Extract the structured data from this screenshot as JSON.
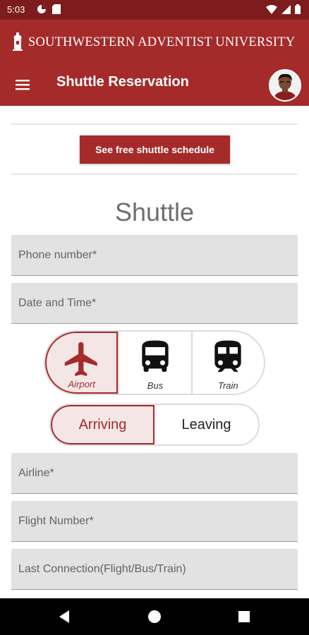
{
  "status_bar": {
    "time": "5:03"
  },
  "brand": {
    "name": "SOUTHWESTERN ADVENTIST UNIVERSITY"
  },
  "app_bar": {
    "title": "Shuttle Reservation"
  },
  "schedule_button": {
    "label": "See free shuttle schedule"
  },
  "section": {
    "title": "Shuttle"
  },
  "fields": {
    "phone": {
      "placeholder": "Phone number*",
      "value": ""
    },
    "date_time": {
      "placeholder": "Date and Time*",
      "value": ""
    },
    "airline": {
      "placeholder": "Airline*",
      "value": ""
    },
    "flight_number": {
      "placeholder": "Flight Number*",
      "value": ""
    },
    "last_connection": {
      "placeholder": "Last Connection(Flight/Bus/Train)",
      "value": ""
    }
  },
  "transport_modes": [
    {
      "label": "Airport",
      "icon": "airplane-icon",
      "selected": true
    },
    {
      "label": "Bus",
      "icon": "bus-icon",
      "selected": false
    },
    {
      "label": "Train",
      "icon": "train-icon",
      "selected": false
    }
  ],
  "direction": [
    {
      "label": "Arriving",
      "selected": true
    },
    {
      "label": "Leaving",
      "selected": false
    }
  ],
  "colors": {
    "brand": "#a52a2a",
    "status_bar": "#7d1c1c",
    "selected_bg": "#f5e6e6",
    "field_bg": "#e2e2e2"
  }
}
